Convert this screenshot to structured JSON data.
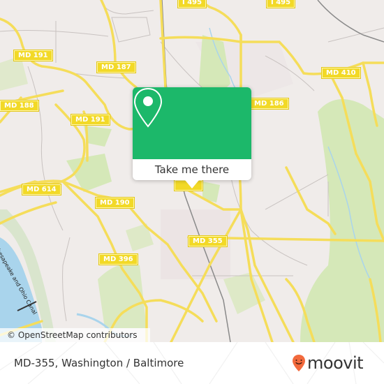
{
  "map": {
    "road_labels": [
      {
        "id": "i495-a",
        "text": "I 495"
      },
      {
        "id": "i495-b",
        "text": "I 495"
      },
      {
        "id": "md191-a",
        "text": "MD 191"
      },
      {
        "id": "md187",
        "text": "MD 187"
      },
      {
        "id": "md188",
        "text": "MD 188"
      },
      {
        "id": "md191-b",
        "text": "MD 191"
      },
      {
        "id": "md410",
        "text": "MD 410"
      },
      {
        "id": "md186",
        "text": "MD 186"
      },
      {
        "id": "md614",
        "text": "MD 614"
      },
      {
        "id": "md190",
        "text": "MD 190"
      },
      {
        "id": "md355",
        "text": "MD 355"
      },
      {
        "id": "md396",
        "text": "MD 396"
      }
    ],
    "waterway_label": "Chesapeake and Ohio Canal",
    "attribution": "© OpenStreetMap contributors",
    "colors": {
      "land": "#f0ecea",
      "park": "#d5e8b8",
      "water": "#a9d4ec",
      "road": "#f5dd5a",
      "popup": "#1cb86a"
    }
  },
  "popup": {
    "icon": "location-pin-icon",
    "button_label": "Take me there"
  },
  "footer": {
    "title": "MD-355, Washington / Baltimore",
    "brand": "moovit",
    "brand_color": "#f26a3d"
  }
}
